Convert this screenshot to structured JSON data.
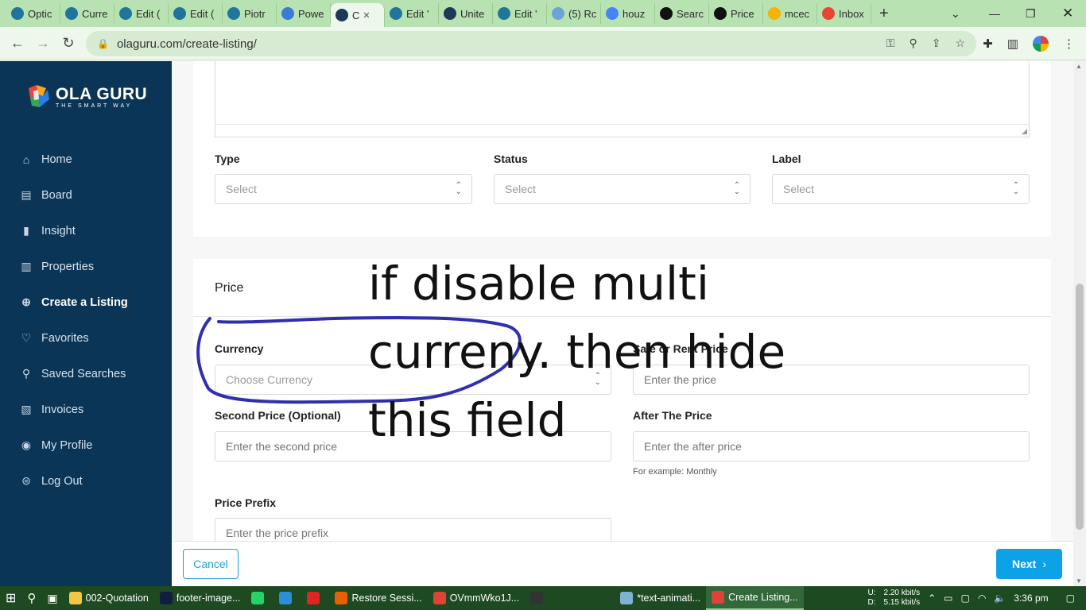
{
  "browser": {
    "tabs": [
      {
        "label": "Optic",
        "icon": "wordpress-icon",
        "color": "#21759b"
      },
      {
        "label": "Curre",
        "icon": "wordpress-icon",
        "color": "#21759b"
      },
      {
        "label": "Edit (",
        "icon": "wordpress-icon",
        "color": "#21759b"
      },
      {
        "label": "Edit (",
        "icon": "wordpress-icon",
        "color": "#21759b"
      },
      {
        "label": "Piotr",
        "icon": "wordpress-icon",
        "color": "#21759b"
      },
      {
        "label": "Powe",
        "icon": "globe-icon",
        "color": "#3a7bd5"
      },
      {
        "label": "C",
        "icon": "olaguru-icon",
        "color": "#1b3a57",
        "active": true
      },
      {
        "label": "Edit '",
        "icon": "wordpress-icon",
        "color": "#21759b"
      },
      {
        "label": "Unite",
        "icon": "olaguru-icon",
        "color": "#1b3a57"
      },
      {
        "label": "Edit '",
        "icon": "wordpress-icon",
        "color": "#21759b"
      },
      {
        "label": "(5) Rc",
        "icon": "balloon-icon",
        "color": "#6aa4d8"
      },
      {
        "label": "houz",
        "icon": "google-icon",
        "color": "#4285f4"
      },
      {
        "label": "Searc",
        "icon": "plus-box-icon",
        "color": "#111111"
      },
      {
        "label": "Price",
        "icon": "plus-box-icon",
        "color": "#111111"
      },
      {
        "label": "mcec",
        "icon": "drive-icon",
        "color": "#f4b400"
      },
      {
        "label": "Inbox",
        "icon": "gmail-icon",
        "color": "#ea4335"
      }
    ],
    "url": "olaguru.com/create-listing/"
  },
  "sidebar": {
    "logo_name": "OLA GURU",
    "logo_tagline": "THE SMART WAY",
    "items": [
      {
        "label": "Home",
        "icon": "home-icon"
      },
      {
        "label": "Board",
        "icon": "board-icon"
      },
      {
        "label": "Insight",
        "icon": "chart-icon"
      },
      {
        "label": "Properties",
        "icon": "building-icon"
      },
      {
        "label": "Create a Listing",
        "icon": "plus-circle-icon",
        "active": true
      },
      {
        "label": "Favorites",
        "icon": "heart-icon"
      },
      {
        "label": "Saved Searches",
        "icon": "search-icon"
      },
      {
        "label": "Invoices",
        "icon": "invoice-icon"
      },
      {
        "label": "My Profile",
        "icon": "user-icon"
      },
      {
        "label": "Log Out",
        "icon": "lock-icon"
      }
    ]
  },
  "details": {
    "type_label": "Type",
    "type_value": "Select",
    "status_label": "Status",
    "status_value": "Select",
    "label_label": "Label",
    "label_value": "Select"
  },
  "price": {
    "section_title": "Price",
    "currency_label": "Currency",
    "currency_value": "Choose Currency",
    "sale_label": "Sale or Rent Price",
    "sale_placeholder": "Enter the price",
    "second_label": "Second Price (Optional)",
    "second_placeholder": "Enter the second price",
    "after_label": "After The Price",
    "after_placeholder": "Enter the after price",
    "after_hint": "For example: Monthly",
    "prefix_label": "Price Prefix",
    "prefix_placeholder": "Enter the price prefix"
  },
  "footer": {
    "cancel_label": "Cancel",
    "next_label": "Next"
  },
  "annotation": {
    "line1": "if disable multi",
    "line2": "curreny. then hide",
    "line3": "this field",
    "color": "#2f2fb0"
  },
  "taskbar": {
    "items": [
      {
        "label": "002-Quotation",
        "icon": "folder-icon",
        "color": "#f2c744"
      },
      {
        "label": "footer-image...",
        "icon": "photoshop-icon",
        "color": "#0f1f3d"
      },
      {
        "label": "",
        "icon": "whatsapp-icon",
        "color": "#25d366"
      },
      {
        "label": "",
        "icon": "edge-icon",
        "color": "#2a8fd6"
      },
      {
        "label": "",
        "icon": "opera-icon",
        "color": "#e02424"
      },
      {
        "label": "Restore Sessi...",
        "icon": "firefox-icon",
        "color": "#e66000"
      },
      {
        "label": "OVmmWko1J...",
        "icon": "chrome-icon",
        "color": "#db4437"
      },
      {
        "label": "",
        "icon": "app-icon",
        "color": "#333333"
      },
      {
        "label": "*text-animati...",
        "icon": "notepad-icon",
        "color": "#7fb3d5"
      },
      {
        "label": "Create Listing...",
        "icon": "chrome-icon",
        "color": "#db4437",
        "active": true
      }
    ],
    "net_up": "U:",
    "net_down": "D:",
    "speed_up": "2.20 kbit/s",
    "speed_down": "5.15 kbit/s",
    "time": "3:36 pm"
  }
}
